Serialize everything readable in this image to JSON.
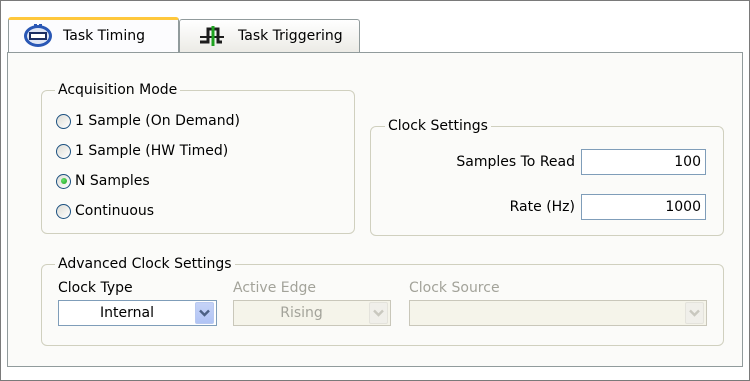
{
  "tabs": [
    {
      "label": "Task Timing",
      "icon": "clock-chip-icon",
      "active": true
    },
    {
      "label": "Task Triggering",
      "icon": "trigger-waveform-icon",
      "active": false
    }
  ],
  "acquisition_mode": {
    "title": "Acquisition Mode",
    "options": [
      {
        "label": "1 Sample (On Demand)",
        "selected": false
      },
      {
        "label": "1 Sample (HW Timed)",
        "selected": false
      },
      {
        "label": "N Samples",
        "selected": true
      },
      {
        "label": "Continuous",
        "selected": false
      }
    ]
  },
  "clock_settings": {
    "title": "Clock Settings",
    "samples_to_read_label": "Samples To Read",
    "samples_to_read_value": "100",
    "rate_label": "Rate (Hz)",
    "rate_value": "1000"
  },
  "advanced_clock_settings": {
    "title": "Advanced Clock Settings",
    "clock_type_label": "Clock Type",
    "clock_type_value": "Internal",
    "active_edge_label": "Active Edge",
    "active_edge_value": "Rising",
    "clock_source_label": "Clock Source",
    "clock_source_value": ""
  },
  "colors": {
    "tab_highlight": "#ffc83c",
    "radio_selected": "#21a121",
    "input_border": "#7f9db9",
    "disabled_text": "#a3a39a"
  }
}
